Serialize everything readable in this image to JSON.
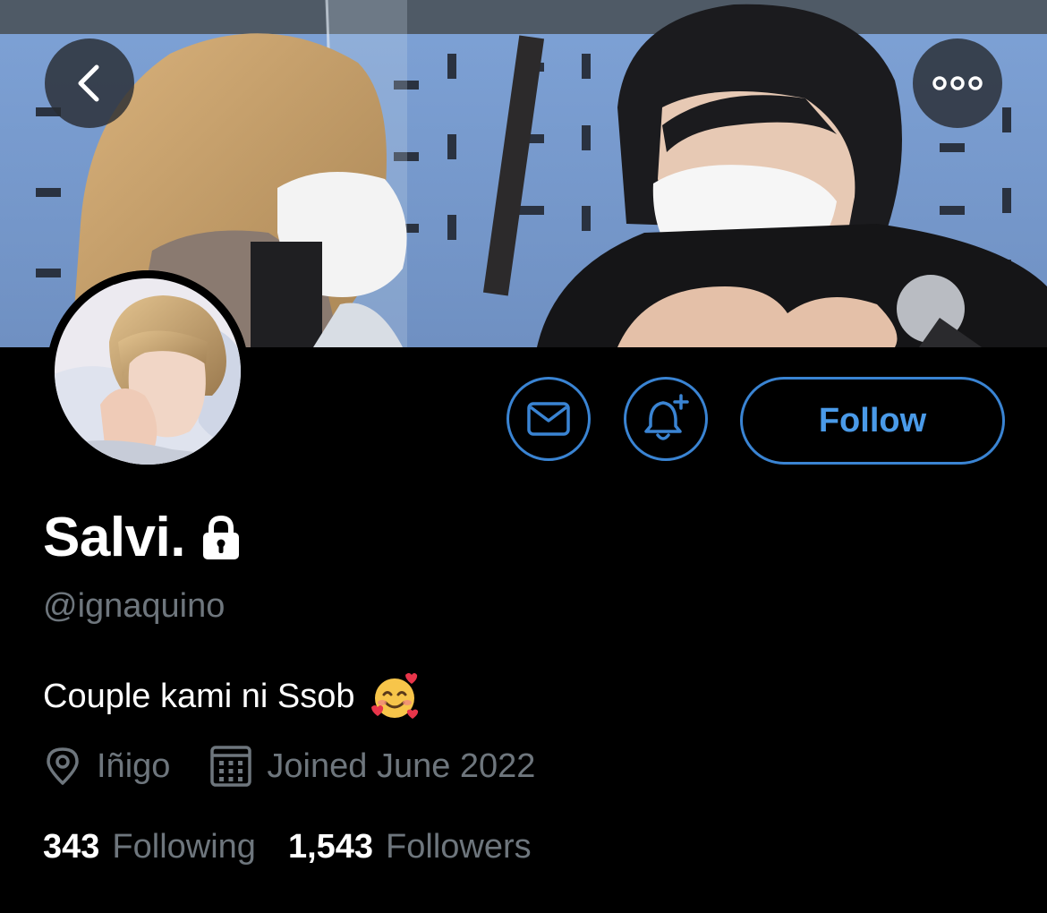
{
  "header": {
    "back_icon": "chevron-left-icon",
    "more_icon": "more-horizontal-icon"
  },
  "profile": {
    "display_name": "Salvi.",
    "protected_icon": "lock-icon",
    "handle": "@ignaquino",
    "bio_text": "Couple kami ni Ssob",
    "bio_emoji": "smiling-face-with-hearts",
    "location": "Iñigo",
    "location_icon": "map-pin-icon",
    "joined": "Joined June 2022",
    "joined_icon": "calendar-icon"
  },
  "actions": {
    "message_icon": "envelope-icon",
    "notify_icon": "bell-plus-icon",
    "follow_label": "Follow"
  },
  "stats": {
    "following_count": "343",
    "following_label": "Following",
    "followers_count": "1,543",
    "followers_label": "Followers"
  },
  "colors": {
    "background": "#000000",
    "accent": "#3a84d3",
    "follow_text": "#4a9ae8",
    "secondary_text": "#6e767d",
    "primary_text": "#ffffff"
  }
}
